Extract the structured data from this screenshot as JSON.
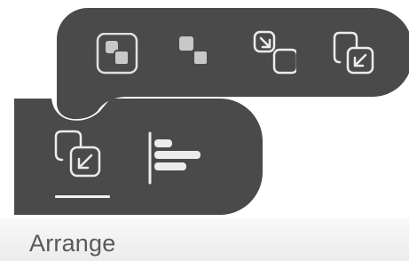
{
  "panel": {
    "title": "Arrange"
  },
  "toolbar": {
    "selected_tool": "bring-to-front"
  },
  "popover": {
    "items": [
      {
        "icon": "bring-to-front-icon",
        "active": true
      },
      {
        "icon": "send-to-back-icon",
        "active": false
      },
      {
        "icon": "send-backward-icon",
        "active": false
      },
      {
        "icon": "bring-forward-icon",
        "active": false
      }
    ]
  },
  "colors": {
    "popover_bg": "#4a4a4a",
    "icon_stroke": "#ececec",
    "icon_fill": "#c8c8c8",
    "panel_text": "#595959"
  }
}
